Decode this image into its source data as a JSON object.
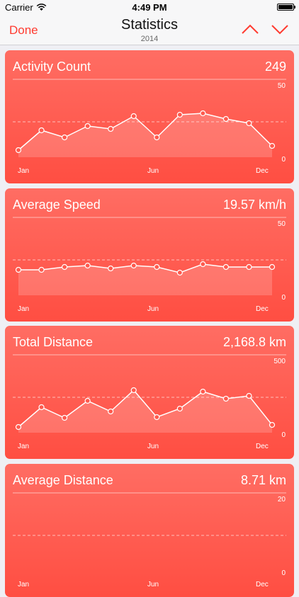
{
  "status_bar": {
    "carrier": "Carrier",
    "time": "4:49 PM"
  },
  "nav": {
    "done_label": "Done",
    "title": "Statistics",
    "subtitle": "2014"
  },
  "colors": {
    "accent": "#ff3b30",
    "card_top": "#ff6d63",
    "card_bottom": "#ff4e42"
  },
  "cards": [
    {
      "title": "Activity Count",
      "value": "249",
      "y_max_label": "50",
      "y_min_label": "0",
      "x_labels": [
        "Jan",
        "Jun",
        "Dec"
      ]
    },
    {
      "title": "Average Speed",
      "value": "19.57 km/h",
      "y_max_label": "50",
      "y_min_label": "0",
      "x_labels": [
        "Jan",
        "Jun",
        "Dec"
      ]
    },
    {
      "title": "Total Distance",
      "value": "2,168.8 km",
      "y_max_label": "500",
      "y_min_label": "0",
      "x_labels": [
        "Jan",
        "Jun",
        "Dec"
      ]
    },
    {
      "title": "Average Distance",
      "value": "8.71 km",
      "y_max_label": "20",
      "y_min_label": "0",
      "x_labels": [
        "Jan",
        "Jun",
        "Dec"
      ]
    }
  ],
  "chart_data": [
    {
      "type": "area",
      "ylim": [
        0,
        50
      ],
      "x": [
        "Jan",
        "Feb",
        "Mar",
        "Apr",
        "May",
        "Jun",
        "Jul",
        "Aug",
        "Sep",
        "Oct",
        "Nov",
        "Dec"
      ],
      "values": [
        5,
        19,
        14,
        22,
        20,
        29,
        14,
        30,
        31,
        27,
        24,
        8
      ]
    },
    {
      "type": "area",
      "ylim": [
        0,
        50
      ],
      "x": [
        "Jan",
        "Feb",
        "Mar",
        "Apr",
        "May",
        "Jun",
        "Jul",
        "Aug",
        "Sep",
        "Oct",
        "Nov",
        "Dec"
      ],
      "values": [
        18,
        18,
        20,
        21,
        19,
        21,
        20,
        16,
        22,
        20,
        20,
        20
      ]
    },
    {
      "type": "area",
      "ylim": [
        0,
        500
      ],
      "x": [
        "Jan",
        "Feb",
        "Mar",
        "Apr",
        "May",
        "Jun",
        "Jul",
        "Aug",
        "Sep",
        "Oct",
        "Nov",
        "Dec"
      ],
      "values": [
        40,
        180,
        105,
        225,
        150,
        300,
        110,
        170,
        290,
        240,
        260,
        55
      ]
    },
    {
      "type": "area",
      "ylim": [
        0,
        20
      ],
      "x": [
        "Jan",
        "Feb",
        "Mar",
        "Apr",
        "May",
        "Jun",
        "Jul",
        "Aug",
        "Sep",
        "Oct",
        "Nov",
        "Dec"
      ],
      "values": []
    }
  ]
}
